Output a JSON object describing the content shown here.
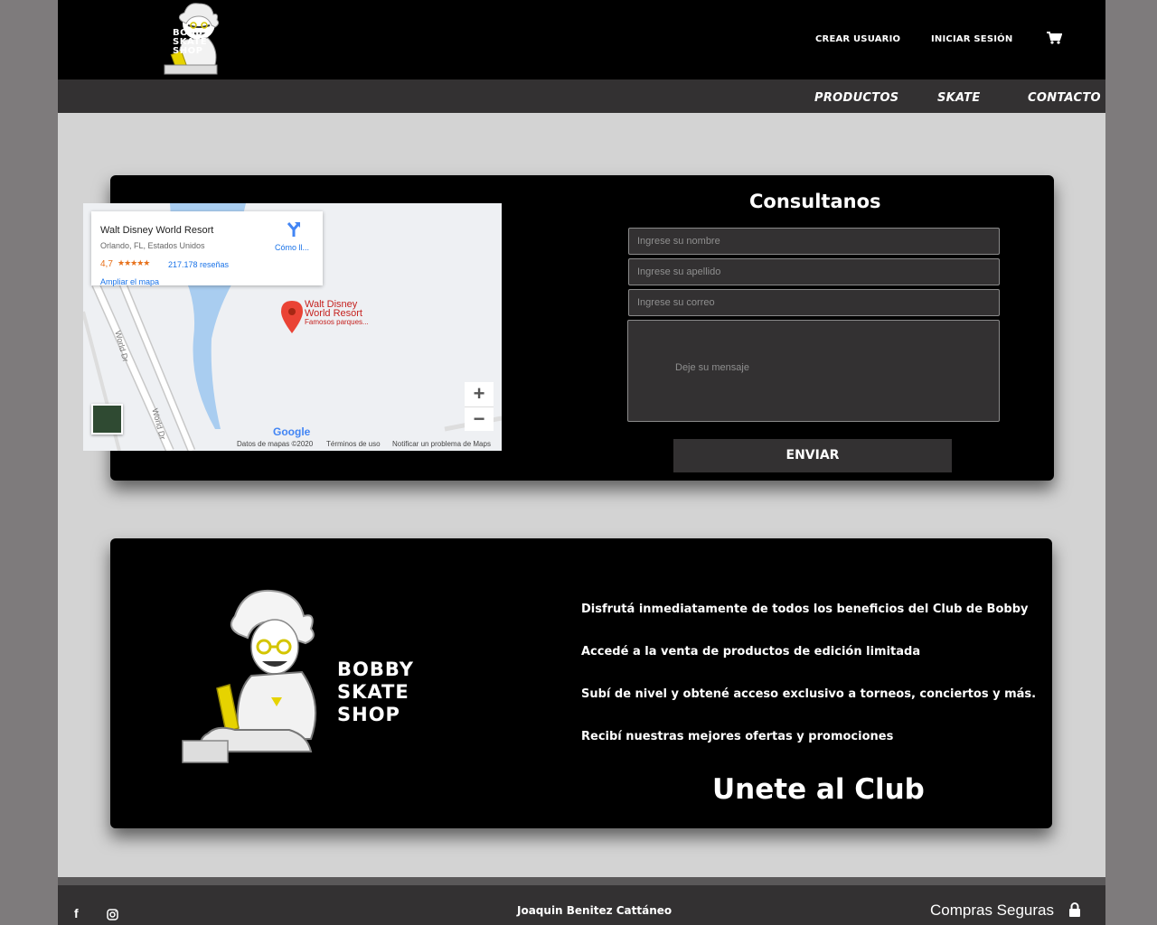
{
  "header": {
    "brand_lines": [
      "BOBBY",
      "SKATE",
      "SHOP"
    ],
    "create_user": "CREAR USUARIO",
    "login": "INICIAR SESIÓN",
    "cart_icon": "shopping-cart-icon"
  },
  "nav": {
    "products": "PRODUCTOS",
    "skate": "SKATE",
    "contact": "CONTACTO"
  },
  "map": {
    "place": "Walt Disney World Resort",
    "address": "Orlando, FL, Estados Unidos",
    "rating": "4,7",
    "stars": "★★★★★",
    "reviews": "217.178 reseñas",
    "enlarge": "Ampliar el mapa",
    "directions": "Cómo ll...",
    "marker_line1": "Walt Disney",
    "marker_line2": "World Resort",
    "marker_sub": "Famosos parques...",
    "road1": "World Dr",
    "road2": "World Dr",
    "zoom_in": "+",
    "zoom_out": "−",
    "google": "Google",
    "map_data": "Datos de mapas ©2020",
    "terms": "Términos de uso",
    "report": "Notificar un problema de Maps"
  },
  "form": {
    "title": "Consultanos",
    "name_placeholder": "Ingrese su nombre",
    "surname_placeholder": "Ingrese su apellido",
    "email_placeholder": "Ingrese su correo",
    "message_placeholder": "Deje su mensaje",
    "submit": "ENVIAR"
  },
  "club": {
    "brand_lines": [
      "BOBBY",
      "SKATE",
      "SHOP"
    ],
    "benefits": [
      "Disfrutá inmediatamente de todos los beneficios del Club de Bobby",
      "Accedé a la venta de productos de edición limitada",
      "Subí de nivel y obtené acceso exclusivo a torneos, conciertos y más.",
      "Recibí nuestras mejores ofertas y promociones"
    ],
    "join": "Unete al Club"
  },
  "footer": {
    "facebook": "f",
    "author": "Joaquin Benitez Cattáneo",
    "secure": "Compras Seguras"
  },
  "colors": {
    "black": "#000000",
    "dark_gray": "#333132",
    "light_gray": "#d3d3d3",
    "outer_gray": "#7e7b7c"
  }
}
